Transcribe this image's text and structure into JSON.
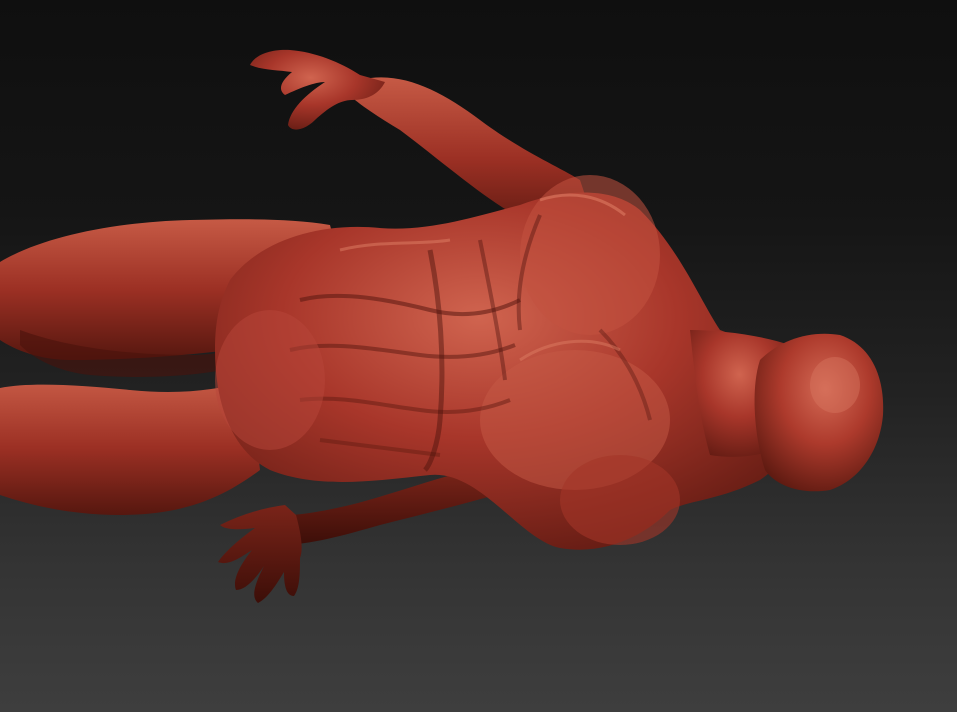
{
  "scene": {
    "subject": "sculpted-figure",
    "colors": {
      "background_top": "#0f0f0f",
      "background_bottom": "#3e3e3e",
      "material_base": "#a8362a",
      "material_highlight": "#d9705a",
      "material_shadow": "#4a120c"
    }
  }
}
